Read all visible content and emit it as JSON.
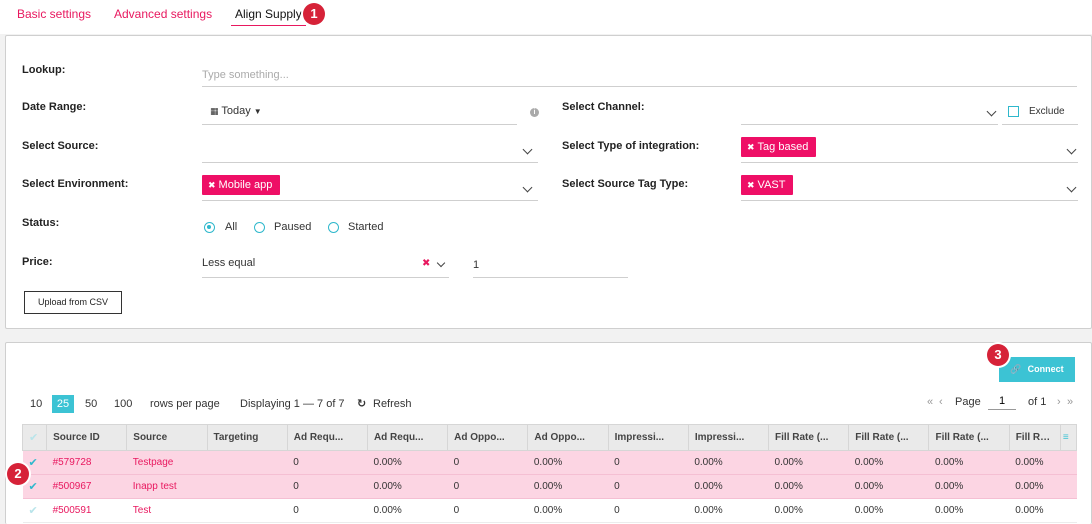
{
  "tabs": [
    {
      "label": "Basic settings"
    },
    {
      "label": "Advanced settings"
    },
    {
      "label": "Align Supply"
    }
  ],
  "badges": [
    "1",
    "2",
    "3"
  ],
  "form": {
    "lookup_label": "Lookup:",
    "lookup_placeholder": "Type something...",
    "date_range_label": "Date Range:",
    "date_range_value": "Today",
    "channel_label": "Select Channel:",
    "exclude_label": "Exclude",
    "source_label": "Select Source:",
    "integration_label": "Select Type of integration:",
    "integration_tag": "Tag based",
    "environment_label": "Select Environment:",
    "environment_tag": "Mobile app",
    "source_tag_type_label": "Select Source Tag Type:",
    "source_tag_type_tag": "VAST",
    "status_label": "Status:",
    "status_options": [
      "All",
      "Paused",
      "Started"
    ],
    "price_label": "Price:",
    "price_operator": "Less equal",
    "price_value": "1",
    "upload_label": "Upload from CSV"
  },
  "grid": {
    "connect_label": "Connect",
    "page_sizes": [
      "10",
      "25",
      "50",
      "100"
    ],
    "active_page_size": "25",
    "rows_per_page": "rows per page",
    "displaying": "Displaying 1 — 7 of 7",
    "refresh_label": "Refresh",
    "page_label": "Page",
    "page_value": "1",
    "page_total": "of 1",
    "columns": [
      "Source ID",
      "Source",
      "Targeting",
      "Ad Requ...",
      "Ad Requ...",
      "Ad Oppo...",
      "Ad Oppo...",
      "Impressi...",
      "Impressi...",
      "Fill Rate (...",
      "Fill Rate (...",
      "Fill Rate (...",
      "Fill Rate (..."
    ],
    "rows": [
      {
        "id": "#579728",
        "source": "Testpage",
        "targeting": "",
        "vals": [
          "0",
          "0.00%",
          "0",
          "0.00%",
          "0",
          "0.00%",
          "0.00%",
          "0.00%",
          "0.00%",
          "0.00%"
        ],
        "selected": true
      },
      {
        "id": "#500967",
        "source": "Inapp test",
        "targeting": "",
        "vals": [
          "0",
          "0.00%",
          "0",
          "0.00%",
          "0",
          "0.00%",
          "0.00%",
          "0.00%",
          "0.00%",
          "0.00%"
        ],
        "selected": true
      },
      {
        "id": "#500591",
        "source": "Test",
        "targeting": "",
        "vals": [
          "0",
          "0.00%",
          "0",
          "0.00%",
          "0",
          "0.00%",
          "0.00%",
          "0.00%",
          "0.00%",
          "0.00%"
        ],
        "selected": false
      }
    ]
  },
  "colors": {
    "accent": "#e8185f",
    "teal": "#3cc3d4",
    "badge": "#d62238",
    "selected_row": "#fcd5e3"
  }
}
